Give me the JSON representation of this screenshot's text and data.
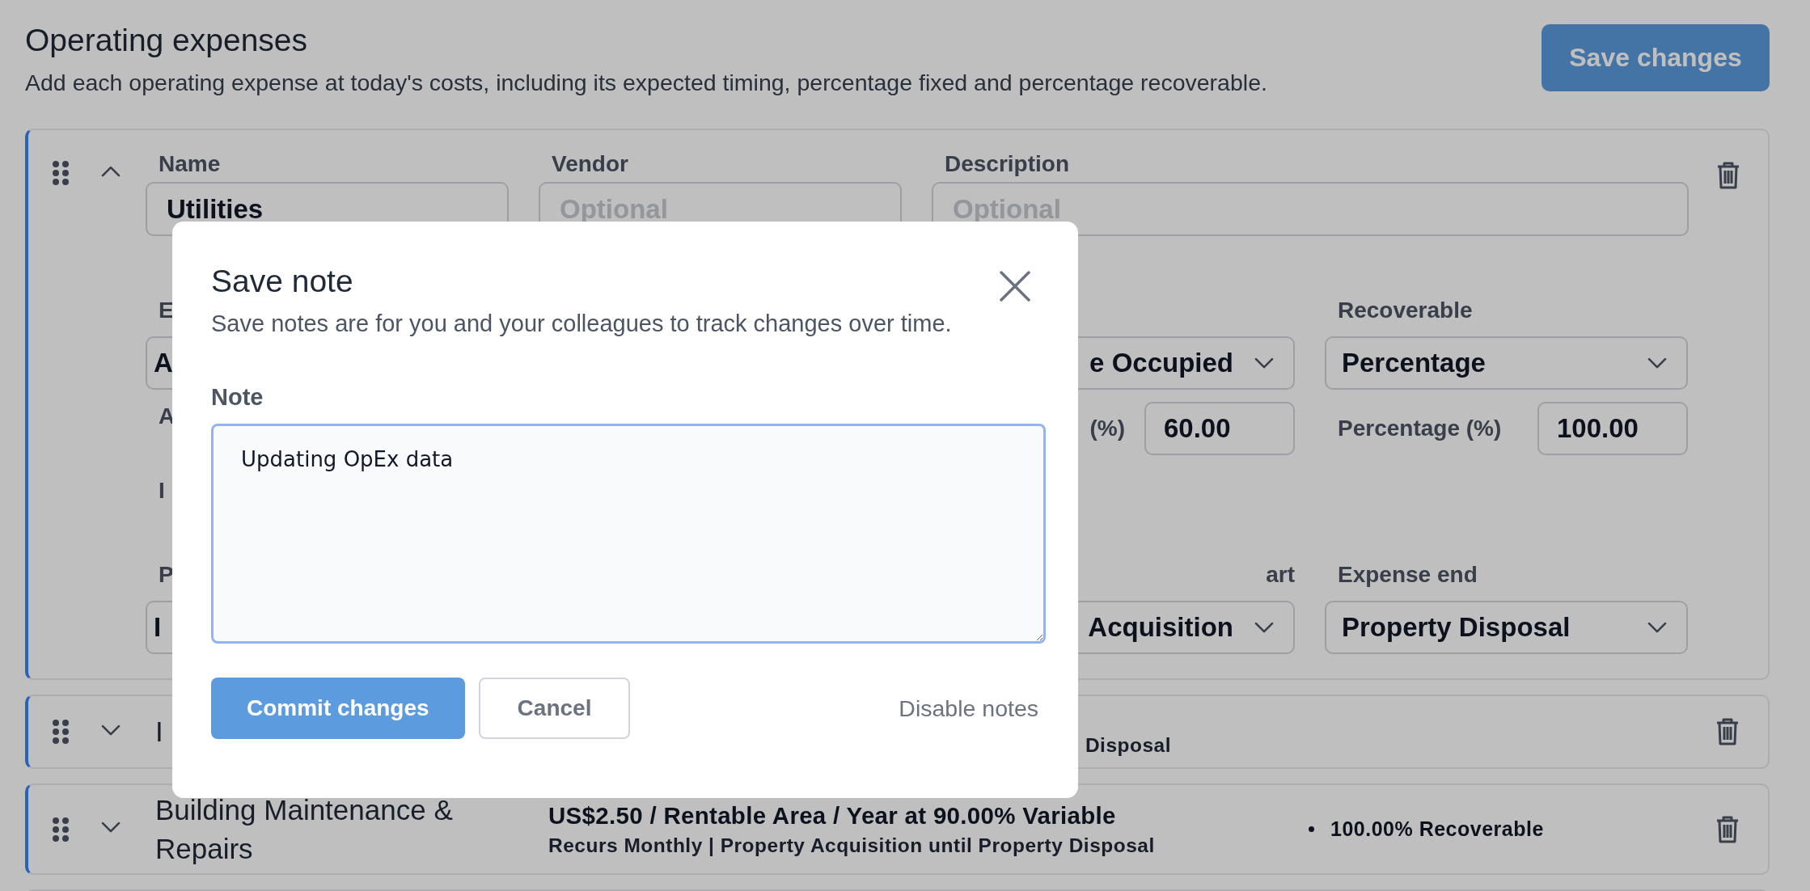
{
  "header": {
    "title": "Operating expenses",
    "subtitle": "Add each operating expense at today's costs, including its expected timing, percentage fixed and percentage recoverable.",
    "save_button": "Save changes"
  },
  "expenses": [
    {
      "expanded": true,
      "name": {
        "label": "Name",
        "value": "Utilities"
      },
      "vendor": {
        "label": "Vendor",
        "placeholder": "Optional"
      },
      "description": {
        "label": "Description",
        "placeholder": "Optional"
      },
      "rows": [
        {
          "left": {
            "kind": "select",
            "label": "E",
            "value": "A"
          },
          "right": [
            {
              "kind": "select",
              "value": "e Occupied"
            },
            {
              "kind": "select",
              "label": "Recoverable",
              "value": "Percentage"
            }
          ]
        },
        {
          "left": {
            "kind": "label",
            "label": "A"
          },
          "right": [
            {
              "kind": "number",
              "label": "(%)",
              "value": "60.00"
            },
            {
              "kind": "number",
              "label": "Percentage (%)",
              "value": "100.00"
            }
          ]
        },
        {
          "left": {
            "kind": "label",
            "label": "I"
          },
          "right": []
        },
        {
          "left": {
            "kind": "select",
            "label": "P",
            "value": "I"
          },
          "right": [
            {
              "kind": "select",
              "label": "art",
              "value": "Acquisition"
            },
            {
              "kind": "select",
              "label": "Expense end",
              "value": "Property Disposal"
            }
          ]
        }
      ]
    },
    {
      "expanded": false,
      "title": "I",
      "summary": [
        "Disposal"
      ]
    },
    {
      "expanded": false,
      "title": "Building Maintenance & Repairs",
      "summary": [
        "US$2.50 / Rentable Area / Year at 90.00% Variable",
        "Recurs Monthly | Property Acquisition until Property Disposal"
      ],
      "bullets": [
        "100.00% Recoverable"
      ]
    }
  ],
  "modal": {
    "title": "Save note",
    "subtitle": "Save notes are for you and your colleagues to track changes over time.",
    "note": {
      "label": "Note",
      "value": "Updating OpEx data"
    },
    "buttons": [
      {
        "label": "Commit changes",
        "kind": "primary"
      },
      {
        "label": "Cancel",
        "kind": "secondary"
      }
    ],
    "link": "Disable notes"
  }
}
